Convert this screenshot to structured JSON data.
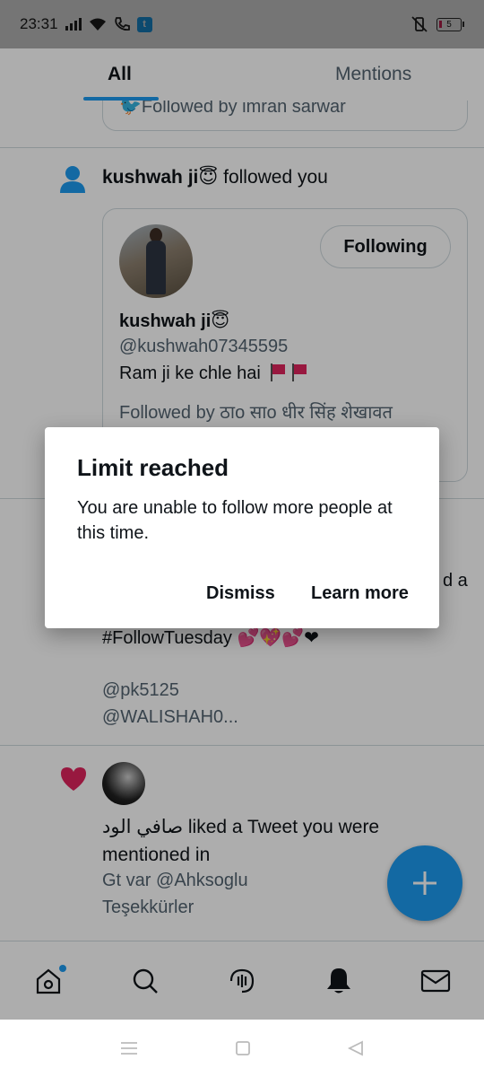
{
  "status_bar": {
    "time": "23:31",
    "battery": "5"
  },
  "tabs": [
    {
      "label": "All"
    },
    {
      "label": "Mentions"
    }
  ],
  "feed": {
    "partial_card_text": "Followed by imran sarwar",
    "follow_notification": {
      "name": "kushwah ji😇",
      "action": "followed you",
      "card": {
        "name": "kushwah ji😇",
        "handle": "@kushwah07345595",
        "bio": "Ram ji ke chle hai",
        "followed_by": "Followed by ठाо साо धीर सिंह शेखावत",
        "follow_button": "Following"
      }
    },
    "retweet_notification": {
      "line_fragment": "d a",
      "hashtag": "#FollowTuesday 💕💖💕❤",
      "mention1": "@pk5125",
      "mention2": "@WALISHAH0..."
    },
    "like_notification": {
      "text": "صافي الود liked a Tweet you were mentioned in",
      "tweet_line1": "Gt var @Ahksoglu",
      "tweet_line2": "Teşekkürler"
    }
  },
  "dialog": {
    "title": "Limit reached",
    "message": "You are unable to follow more people at this time.",
    "dismiss": "Dismiss",
    "learn_more": "Learn more"
  },
  "colors": {
    "accent": "#1d9bf0",
    "like": "#e0245e"
  }
}
